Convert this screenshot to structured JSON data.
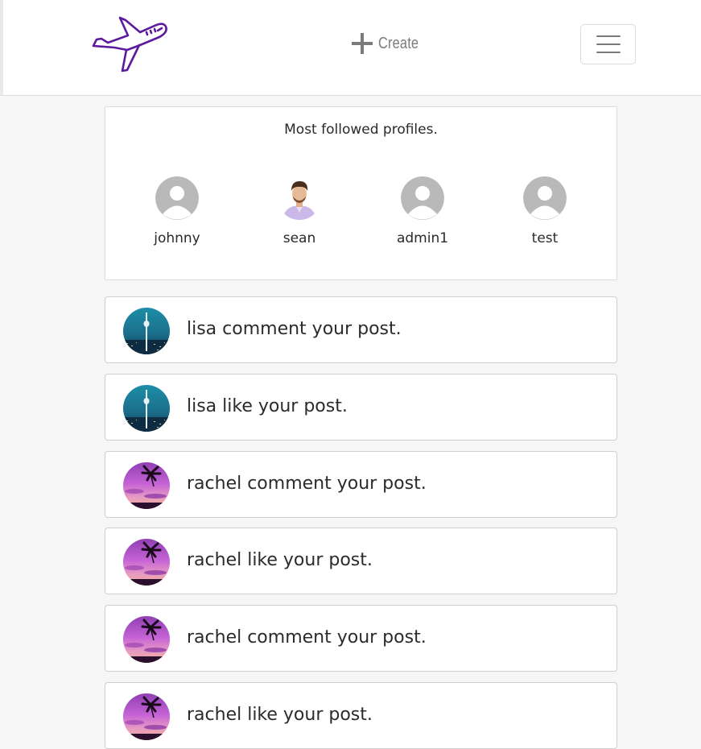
{
  "header": {
    "logo_icon": "airplane-icon",
    "create_icon": "plus-icon",
    "create_label": "Create",
    "menu_icon": "hamburger-menu-icon",
    "brand_color": "#5c1a9e"
  },
  "most_followed": {
    "title": "Most followed profiles.",
    "profiles": [
      {
        "name": "johnny",
        "avatar": "default-avatar-icon"
      },
      {
        "name": "sean",
        "avatar": "photo"
      },
      {
        "name": "admin1",
        "avatar": "default-avatar-icon"
      },
      {
        "name": "test",
        "avatar": "default-avatar-icon"
      }
    ]
  },
  "notifications": [
    {
      "text": "lisa comment your post.",
      "avatar": "city-tower-photo"
    },
    {
      "text": "lisa like your post.",
      "avatar": "city-tower-photo"
    },
    {
      "text": "rachel comment your post.",
      "avatar": "purple-sunset-photo"
    },
    {
      "text": "rachel like your post.",
      "avatar": "purple-sunset-photo"
    },
    {
      "text": "rachel comment your post.",
      "avatar": "purple-sunset-photo"
    },
    {
      "text": "rachel like your post.",
      "avatar": "purple-sunset-photo"
    }
  ]
}
